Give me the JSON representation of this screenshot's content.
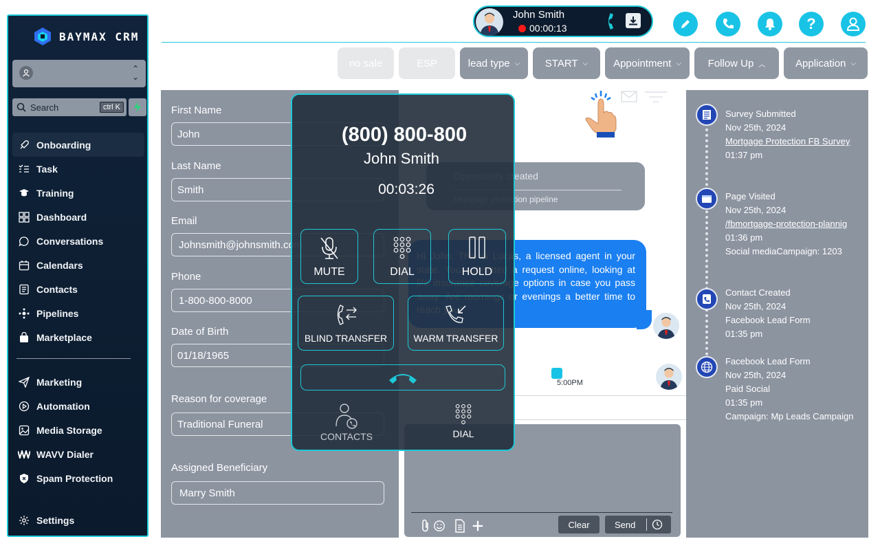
{
  "brand": {
    "name": "BAYMAX CRM"
  },
  "sidebar": {
    "account_label": "",
    "search": {
      "placeholder": "Search",
      "shortcut": "ctrl K"
    },
    "nav_primary": [
      {
        "label": "Onboarding",
        "icon": "rocket-icon",
        "active": true
      },
      {
        "label": "Task",
        "icon": "checklist-icon"
      },
      {
        "label": "Training",
        "icon": "graduation-cap-icon"
      },
      {
        "label": "Dashboard",
        "icon": "grid-icon"
      },
      {
        "label": "Conversations",
        "icon": "chat-bubble-icon"
      },
      {
        "label": "Calendars",
        "icon": "calendar-icon"
      },
      {
        "label": "Contacts",
        "icon": "contact-card-icon"
      },
      {
        "label": "Pipelines",
        "icon": "pipeline-icon"
      },
      {
        "label": "Marketplace",
        "icon": "shopping-bag-icon"
      }
    ],
    "nav_secondary": [
      {
        "label": "Marketing",
        "icon": "send-icon"
      },
      {
        "label": "Automation",
        "icon": "play-circle-icon"
      },
      {
        "label": "Media Storage",
        "icon": "image-icon"
      },
      {
        "label": "WAVV Dialer",
        "icon": "wavv-icon"
      },
      {
        "label": "Spam Protection",
        "icon": "shield-icon"
      }
    ],
    "settings_label": "Settings"
  },
  "header": {
    "active_call": {
      "name": "John Smith",
      "timer": "00:00:13"
    },
    "icons": [
      "pencil-icon",
      "phone-icon",
      "bell-icon",
      "help-icon",
      "user-icon"
    ]
  },
  "stages": [
    {
      "label": "no sale",
      "dim": true
    },
    {
      "label": "ESP",
      "dim": true
    },
    {
      "label": "lead type",
      "chevron": "down"
    },
    {
      "label": "START",
      "chevron": "down"
    },
    {
      "label": "Appointment",
      "chevron": "down"
    },
    {
      "label": "Follow Up",
      "chevron": "up"
    },
    {
      "label": "Application",
      "chevron": "down"
    }
  ],
  "contact_form": {
    "first_name": {
      "label": "First Name",
      "value": "John"
    },
    "last_name": {
      "label": "Last Name",
      "value": "Smith"
    },
    "email": {
      "label": "Email",
      "value": "Johnsmith@johnsmith.com"
    },
    "phone": {
      "label": "Phone",
      "value": "1-800-800-8000"
    },
    "dob": {
      "label": "Date of Birth",
      "value": "01/18/1965"
    },
    "reason": {
      "label": "Reason for coverage",
      "value": "Traditional Funeral"
    },
    "beneficiary": {
      "label": "Assigned Beneficiary",
      "value": "Marry Smith"
    }
  },
  "conversation": {
    "opportunity": {
      "title": "Opportunity created",
      "subtitle": "Mortgage protection pipeline"
    },
    "sms": "Hi John, This is Lucas, a licensed agent in your state. You submitted a request online, looking at life insurance coverage options in case you pass away. Are mornings or evenings a better time to reach you?",
    "call_log_time": "5:00PM",
    "compose": {
      "clear_label": "Clear",
      "send_label": "Send"
    }
  },
  "dialer": {
    "number": "(800) 800-800",
    "name": "John Smith",
    "timer": "00:03:26",
    "buttons": {
      "mute": "MUTE",
      "dial": "DIAL",
      "hold": "HOLD",
      "blind_transfer": "BLIND TRANSFER",
      "warm_transfer": "WARM TRANSFER"
    },
    "footer": {
      "contacts": "CONTACTS",
      "dial": "DIAL"
    }
  },
  "timeline": [
    {
      "icon": "survey-icon",
      "lines": [
        "Survey Submitted",
        "Nov 25th, 2024",
        "Mortgage Protection FB Survey",
        "01:37 pm"
      ],
      "underline_index": 2
    },
    {
      "icon": "browser-window-icon",
      "lines": [
        "Page Visited",
        "Nov 25th, 2024",
        "/fbmortgage-protection-plannig",
        "01:36 pm",
        "Social mediaCampaign: 1203"
      ],
      "underline_index": 2
    },
    {
      "icon": "contact-phone-icon",
      "lines": [
        "Contact Created",
        "Nov 25th, 2024",
        "Facebook Lead Form",
        "01:35 pm"
      ]
    },
    {
      "icon": "globe-icon",
      "lines": [
        "Facebook Lead Form",
        "Nov 25th, 2024",
        "Paid Social",
        "01:35 pm",
        "Campaign: Mp Leads Campaign"
      ]
    }
  ],
  "colors": {
    "accent": "#1ec8d6",
    "sidebar_bg": "#0b1a2c",
    "panel_gray": "#8c94a0",
    "sms_blue": "#1a7ff0",
    "header_icon": "#19c3e6",
    "record_red": "#ff1a1a"
  }
}
